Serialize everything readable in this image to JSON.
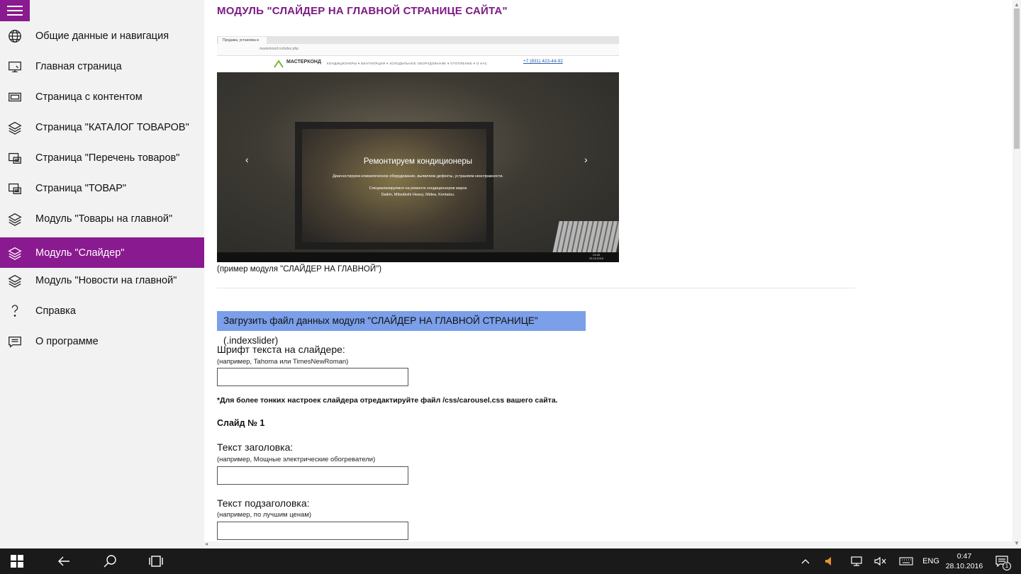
{
  "sidebar": {
    "items": [
      {
        "label": "Общие данные и навигация",
        "icon": "globe-icon",
        "active": false
      },
      {
        "label": "Главная страница",
        "icon": "monitor-icon",
        "active": false
      },
      {
        "label": "Страница с контентом",
        "icon": "page-icon",
        "active": false
      },
      {
        "label": "Страница \"КАТАЛОГ ТОВАРОВ\"",
        "icon": "layers-icon",
        "active": false
      },
      {
        "label": "Страница \"Перечень товаров\"",
        "icon": "list-page-icon",
        "active": false
      },
      {
        "label": "Страница \"ТОВАР\"",
        "icon": "product-page-icon",
        "active": false
      },
      {
        "label": "Модуль \"Товары на главной\"",
        "icon": "layers-icon",
        "active": false
      },
      {
        "label": "Модуль \"Слайдер\"",
        "icon": "layers-icon",
        "active": true
      },
      {
        "label": "Модуль \"Новости на главной\"",
        "icon": "layers-icon",
        "active": false
      },
      {
        "label": "Справка",
        "icon": "question-icon",
        "active": false
      },
      {
        "label": "О программе",
        "icon": "message-icon",
        "active": false
      }
    ],
    "accent_color": "#8a1a8f"
  },
  "main": {
    "title": "МОДУЛЬ \"СЛАЙДЕР НА ГЛАВНОЙ СТРАНИЦЕ САЙТА\"",
    "preview": {
      "tab_text": "Продажа, установка в",
      "url": "masterkond.ru/index.php",
      "logo": "МАСТЕРКОНД",
      "menu": "КОНДИЦИОНЕРЫ ▾   ВЕНТИЛЯЦИЯ ▾   ХОЛОДИЛЬНОЕ ОБОРУДОВАНИЕ ▾   ОТОПЛЕНИЕ ▾   О НАС",
      "phone": "+7 (831) 423-44-92",
      "slide_heading": "Ремонтируем кондиционеры",
      "slide_text_1": "Диагностируем климатическое оборудование, выявляем дефекты, устраняем неисправности.",
      "slide_text_2": "Специализируемся на ремонте кондиционеров марок",
      "slide_text_3": "Daikin, Mitsubishi Heavy, Midea, Kentatsu.",
      "clock_time": "23:45",
      "clock_date": "25.10.2016"
    },
    "preview_caption": "(пример модуля \"СЛАЙДЕР НА ГЛАВНОЙ\")",
    "upload_button": "Загрузить файл данных модуля \"СЛАЙДЕР НА ГЛАВНОЙ СТРАНИЦЕ\"(.indexslider)",
    "font_field": {
      "label": "Шрифт текста на слайдере:",
      "hint": "(например, Tahoma или TimesNewRoman)",
      "value": ""
    },
    "note": "*Для более тонких настроек слайдера отредактируйте файл /css/carousel.css вашего сайта.",
    "slide_heading": "Слайд № 1",
    "title_field": {
      "label": "Текст заголовка:",
      "hint": "(например, Мощные электрические обогреватели)",
      "value": ""
    },
    "subtitle_field": {
      "label": "Текст подзаголовка:",
      "hint": "(например, по лучшим ценам)",
      "value": ""
    },
    "title_color": "#7d1a85",
    "button_color": "#7b9fe9"
  },
  "taskbar": {
    "language": "ENG",
    "time": "0:47",
    "date": "28.10.2016",
    "notification_count": "1"
  }
}
